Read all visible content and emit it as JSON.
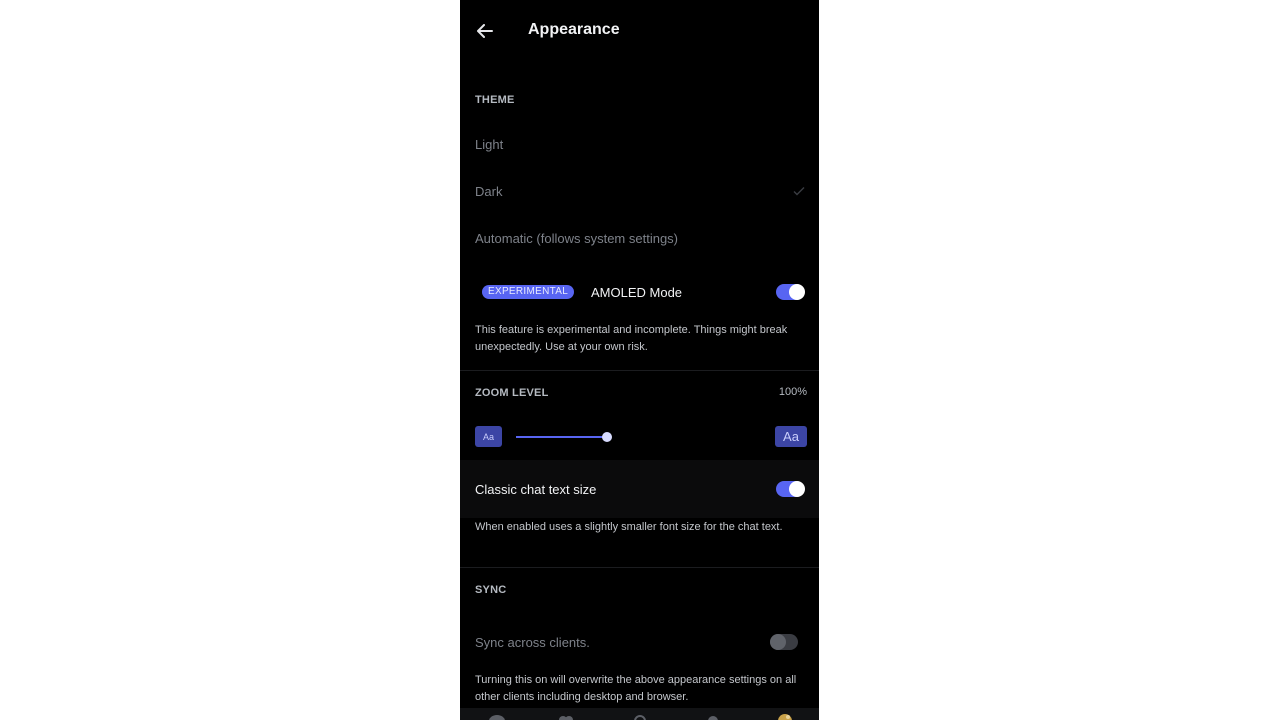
{
  "header": {
    "title": "Appearance",
    "back_icon": "arrow-left-icon"
  },
  "theme": {
    "section_label": "THEME",
    "options": [
      {
        "label": "Light",
        "selected": false
      },
      {
        "label": "Dark",
        "selected": true
      },
      {
        "label": "Automatic (follows system settings)",
        "selected": false
      }
    ],
    "check_icon": "check-icon"
  },
  "amoled": {
    "badge": "EXPERIMENTAL",
    "label": "AMOLED Mode",
    "enabled": true,
    "description": "This feature is experimental and incomplete. Things might break unexpectedly. Use at your own risk."
  },
  "zoom": {
    "section_label": "ZOOM LEVEL",
    "value_text": "100%",
    "slider_fraction": 0.95,
    "small_aa": "Aa",
    "large_aa": "Aa"
  },
  "classic_chat": {
    "label": "Classic chat text size",
    "enabled": true,
    "description": "When enabled uses a slightly smaller font size for the chat text."
  },
  "sync": {
    "section_label": "SYNC",
    "label": "Sync across clients.",
    "enabled": false,
    "description": "Turning this on will overwrite the above appearance settings on all other clients including desktop and browser."
  },
  "colors": {
    "accent": "#5865f2",
    "background": "#000000"
  },
  "bottom_nav": {
    "icons": [
      "home-icon",
      "friends-icon",
      "search-icon",
      "notifications-icon",
      "profile-avatar-icon"
    ]
  }
}
